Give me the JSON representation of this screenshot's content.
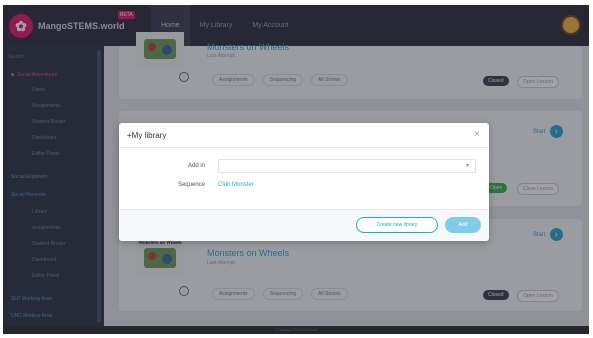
{
  "header": {
    "logo_text": "MangoSTEMS.world",
    "logo_badge": "BETA",
    "nav": [
      {
        "label": "Home"
      },
      {
        "label": "My Library"
      },
      {
        "label": "My Account"
      }
    ]
  },
  "sidebar": {
    "search_label": "Search",
    "items": [
      {
        "label": "Social Adventures"
      },
      {
        "label": "Users"
      },
      {
        "label": "Assignments"
      },
      {
        "label": "Student Roster"
      },
      {
        "label": "Dashboard"
      },
      {
        "label": "Editor Panel"
      },
      {
        "label": "Social Explorers"
      },
      {
        "label": "Social Pioneers"
      },
      {
        "label": "Library"
      },
      {
        "label": "Assignments"
      },
      {
        "label": "Student Roster"
      },
      {
        "label": "Dashboard"
      },
      {
        "label": "Editor Panel"
      },
      {
        "label": "SLP Working Area"
      },
      {
        "label": "UNC Medical Area"
      }
    ]
  },
  "cards": [
    {
      "title": "Monsters on Wheels",
      "subtitle": "Last Attempt",
      "links": [
        "Assignments",
        "Sequencing",
        "All Stories"
      ],
      "status": "Closed",
      "secondary": "Open Lesson"
    },
    {
      "start_label": "Start",
      "status": "Open",
      "secondary": "Close Lesson"
    },
    {
      "thumb_title": "Monsters on Wheels",
      "title": "Monsters on Wheels",
      "subtitle": "Last Attempt",
      "start_label": "Start",
      "links": [
        "Assignments",
        "Sequencing",
        "All Stories"
      ],
      "status": "Closed",
      "secondary": "Open Lesson"
    }
  ],
  "modal": {
    "title": "+My library",
    "close_glyph": "×",
    "add_in_label": "Add in",
    "add_in_value": "",
    "dropdown_glyph": "▾",
    "sequence_label": "Sequence",
    "sequence_value": "Club Monster",
    "create_button": "Create new library",
    "add_button": "Add"
  },
  "footer": {
    "text": "© MangoSTEMS.World"
  },
  "colors": {
    "accent": "#2aa6d6",
    "brand": "#e21b6b",
    "topbar": "#2f2f3d",
    "sidebar": "#2d3346"
  }
}
